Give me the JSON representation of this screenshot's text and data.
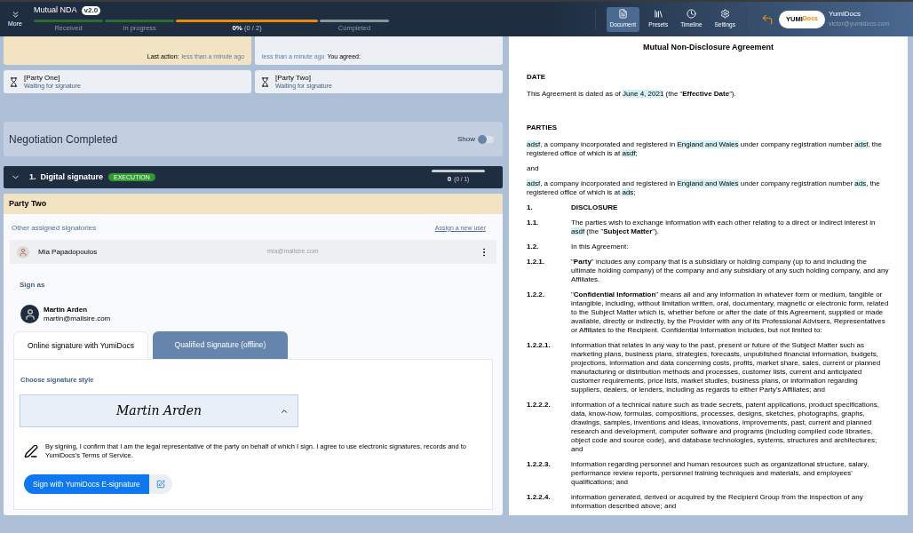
{
  "header": {
    "more_label": "More",
    "doc_title": "Mutual NDA",
    "version": "v2.0",
    "stages": [
      {
        "label": "Received",
        "completed": true,
        "current": false
      },
      {
        "label": "In progress",
        "completed": true,
        "current": false
      },
      {
        "label": "0%",
        "sublabel": "(0 / 2)",
        "completed": false,
        "current": true
      },
      {
        "label": "Completed",
        "completed": false,
        "current": false
      }
    ],
    "nav": [
      {
        "label": "Document",
        "selected": true
      },
      {
        "label": "Presets",
        "selected": false
      },
      {
        "label": "Timeline",
        "selected": false
      },
      {
        "label": "Settings",
        "selected": false
      }
    ],
    "logo_main": "YUMI",
    "logo_accent": "Docs",
    "user_name": "YumiDocs",
    "user_email": "victor@yumidocs.com"
  },
  "activity": [
    {
      "kind": "own",
      "label": "Last action:",
      "time": "less than a minute ago"
    },
    {
      "kind": "other",
      "label": "You agreed:",
      "time": "less than a minute ago"
    }
  ],
  "parties": [
    {
      "name": "[Party One]",
      "status": "Waiting for signature"
    },
    {
      "name": "[Party Two]",
      "status": "Waiting for signature"
    }
  ],
  "negotiation": {
    "title": "Negotiation Completed",
    "toggle_label": "Show",
    "on": false
  },
  "step": {
    "number": "1.",
    "title": "Digital signature",
    "badge": "EXECUTION",
    "level": 0,
    "count": "0",
    "count_detail": "(0 / 1)",
    "expanded": true
  },
  "party_panel": {
    "title": "Party Two",
    "others_label": "Other assigned signatories",
    "assign_link": "Assign a new user",
    "signatories": [
      {
        "name": "Mia Papadopoulos",
        "email": "mia@mailsire.com"
      }
    ],
    "sign_as_label": "Sign as",
    "signer_name": "Martin Arden",
    "signer_email": "martin@mailsire.com",
    "tabs": [
      {
        "label": "Online signature with YumiDocs",
        "selected": true
      },
      {
        "label": "Qualified Signature (offline)",
        "selected": false
      }
    ],
    "style_label": "Choose signature style",
    "signature": "Martin Arden",
    "style_expanded": true,
    "consent": "By signing, I confirm that I am the legal representative of the party on behalf of which I sign. I agree to use electronic signatures, records and to YumiDocs's Terms of Service.",
    "sign_button": "Sign with YumiDocs E-signature"
  },
  "document": {
    "title": "Mutual Non-Disclosure Agreement",
    "blocks": [
      {
        "kind": "heading",
        "text": "DATE"
      },
      {
        "kind": "para",
        "segments": [
          {
            "text": "This Agreement is dated as of ",
            "hl": false
          },
          {
            "text": "June 4, 2021",
            "hl": true
          },
          {
            "text": " (the “**Effective Date**”).",
            "hl": false
          }
        ]
      },
      {
        "kind": "spacer"
      },
      {
        "kind": "heading",
        "text": "PARTIES"
      },
      {
        "kind": "para",
        "segments": [
          {
            "text": "adsf",
            "hl": true
          },
          {
            "text": ", a company incorporated and registered in ",
            "hl": false
          },
          {
            "text": "England and Wales",
            "hl": true
          },
          {
            "text": " under company registration number ",
            "hl": false
          },
          {
            "text": "adsf",
            "hl": true
          },
          {
            "text": ", the registered office of which is at ",
            "hl": false
          },
          {
            "text": "asdf",
            "hl": true
          },
          {
            "text": ";",
            "hl": false
          }
        ]
      },
      {
        "kind": "para",
        "segments": [
          {
            "text": "and",
            "hl": false
          }
        ]
      },
      {
        "kind": "para",
        "segments": [
          {
            "text": "adsf",
            "hl": true
          },
          {
            "text": ", a company incorporated and registered in ",
            "hl": false
          },
          {
            "text": "England and Wales",
            "hl": true
          },
          {
            "text": " under company registration number ",
            "hl": false
          },
          {
            "text": "ads",
            "hl": true
          },
          {
            "text": ", the registered office of which is at ",
            "hl": false
          },
          {
            "text": "ads",
            "hl": true
          },
          {
            "text": ";",
            "hl": false
          }
        ]
      },
      {
        "kind": "clause",
        "number": "1.",
        "segments": [
          {
            "text": "**DISCLOSURE**",
            "hl": false
          }
        ]
      },
      {
        "kind": "clause",
        "number": "1.1.",
        "segments": [
          {
            "text": "The parties wish to exchange information with each other relating to a direct or indirect interest in ",
            "hl": false
          },
          {
            "text": "asdf",
            "hl": true
          },
          {
            "text": " (the \"**Subject Matter**\").",
            "hl": false
          }
        ]
      },
      {
        "kind": "clause",
        "number": "1.2.",
        "segments": [
          {
            "text": "In this Agreement:",
            "hl": false
          }
        ]
      },
      {
        "kind": "clause",
        "number": "1.2.1.",
        "segments": [
          {
            "text": "\"**Party**\" includes any company that is a subsidiary or holding company (up to and including the ultimate holding company) of the company and any subsidiary of any such holding company, and any Affiliates.",
            "hl": false
          }
        ]
      },
      {
        "kind": "clause",
        "number": "1.2.2.",
        "segments": [
          {
            "text": "\"**Confidential Information**\" means all and any information in whatever form or medium, tangible or intangible, including, without limitation written, oral, documentary, magnetic or electronic form, related to the Subject Matter which is, whether before or after the date of this Agreement, supplied or made available, directly or indirectly, by the Provider with any of its Professional Advisers, Representatives or Affiliates to the Recipient. Confidential Information includes, but not limited to:",
            "hl": false
          }
        ]
      },
      {
        "kind": "clause",
        "number": "1.2.2.1.",
        "segments": [
          {
            "text": "information that relates in any way to the past, present or future of the Subject Matter such as marketing plans, business plans, strategies, forecasts, unpublished financial information, budgets, projections, information and data concerning costs, profits, market share, sales, current or planned manufacturing or distribution methods and processes, customer lists, current and anticipated customer requirements, price lists, market studies, business plans, or information regarding suppliers, dealers, or lenders, including as regards to either Party's Affiliates; and",
            "hl": false
          }
        ]
      },
      {
        "kind": "clause",
        "number": "1.2.2.2.",
        "segments": [
          {
            "text": "information of a technical nature such as trade secrets, patent applications, product specifications, data, know-how, formulas, compositions, processes, designs, sketches, photographs, graphs, drawings, samples, inventions and ideas, innovations, improvements, past, current and planned research and development, computer software and programs (including compiled code libraries, object code and source code), and database technologies, systems, structures and architectures; and",
            "hl": false
          }
        ]
      },
      {
        "kind": "clause",
        "number": "1.2.2.3.",
        "segments": [
          {
            "text": "information regarding personnel and human resources such as organizational structure, salary, performance review reports, personnel training techniques and materials, and employees' qualifications; and",
            "hl": false
          }
        ]
      },
      {
        "kind": "clause",
        "number": "1.2.2.4.",
        "segments": [
          {
            "text": "information generated, derived or acquired by the Recipient Group from the inspection of any information described above; and",
            "hl": false
          }
        ]
      }
    ]
  }
}
